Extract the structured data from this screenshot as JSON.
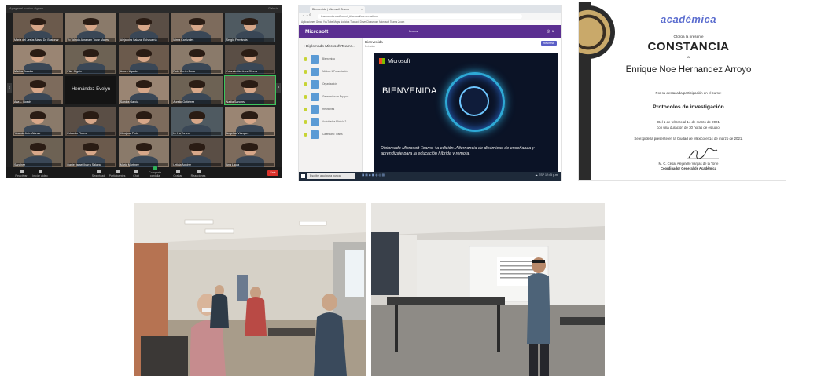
{
  "zoom": {
    "topbar_left": "Apagar el sonido alguno",
    "topbar_right": "Galería",
    "tiles": [
      {
        "name": "María del Jesús Alessi De Bastonar",
        "selected": false
      },
      {
        "name": "Yo Tolinda Abraham Tovar Mares",
        "selected": false
      },
      {
        "name": "Alejandra Salazar Echavarría",
        "selected": false
      },
      {
        "name": "Mirna Carrizales",
        "selected": false
      },
      {
        "name": "Sergio Fernández",
        "selected": false
      },
      {
        "name": "Martha Sandra",
        "selected": false
      },
      {
        "name": "Pilar Olguín",
        "selected": false
      },
      {
        "name": "Arturo Ugalde",
        "selected": false
      },
      {
        "name": "Rubí Cerón Bosa",
        "selected": false
      },
      {
        "name": "Yolanda Martínez Olvera",
        "selected": false
      },
      {
        "name": "Ana L. Bosch",
        "selected": false
      },
      {
        "name": "Hernández Evelyn",
        "selected": false,
        "textonly": true
      },
      {
        "name": "Sandra García",
        "selected": false
      },
      {
        "name": "Aurelio Gutiérrez",
        "selected": false
      },
      {
        "name": "Nadia Sánchez",
        "selected": true
      },
      {
        "name": "Yesenia Jaén Alonso",
        "selected": false
      },
      {
        "name": "Eduardo Flores",
        "selected": false
      },
      {
        "name": "Hinojosa Pinto",
        "selected": false
      },
      {
        "name": "Le Ha Torres",
        "selected": false
      },
      {
        "name": "Angelica Vázquez",
        "selected": false
      },
      {
        "name": "Sánchez",
        "selected": false
      },
      {
        "name": "Daniel Israel Ibarra Salazar",
        "selected": false
      },
      {
        "name": "Mario Martínez",
        "selected": false
      },
      {
        "name": "Leticia Aguirre",
        "selected": false
      },
      {
        "name": "Ana Laura",
        "selected": false
      }
    ],
    "controls": [
      "Reactivar",
      "Iniciar vídeo",
      "Seguridad",
      "Participantes",
      "Chat",
      "Compartir pantalla",
      "Grabar",
      "Reacciones"
    ],
    "end_label": "Salir"
  },
  "teams": {
    "tab_title": "Bienvenida | Microsoft Teams",
    "url": "teams.microsoft.com/_#/school/conversations",
    "bookmarks": "Aplicaciones   Gmail   YouTube   Maps   Noticias   Traducir   Drive   Classroom   Microsoft Teams   Zoom",
    "brand": "Microsoft",
    "search_label": "Buscar",
    "topicons": "⋯  ◎  ☺",
    "back_label": "‹  Diplomado Microsoft Teams...",
    "channel_title": "Bienvenida",
    "channel_sub": "Entradas",
    "meet_button": "Reunirse",
    "sidebar_items": [
      "Bienvenida",
      "Módulo 1 Presentación",
      "Organización",
      "Generación de Equipos",
      "Reuniones",
      "Actividades Módulo 2",
      "Calendario Teams"
    ],
    "video_logo": "Microsoft",
    "video_welcome": "BIENVENIDA",
    "video_caption": "Diplomado Microsoft Teams 4a edición. Alternancia de dinámicas de enseñanza y aprendizaje para la educación híbrida y remota.",
    "search_taskbar": "Escribe aquí para buscar",
    "tray": "☁ ESP  12:45 p.m."
  },
  "certificate": {
    "logo": "académica",
    "intro": "Otorga la presente",
    "title": "CONSTANCIA",
    "a": "a",
    "recipient": "Enrique Noe Hernandez Arroyo",
    "reason": "Por su destacada participación en el curso:",
    "course": "Protocolos de investigación",
    "dates": "Del 1 de febrero al 14 de marzo de 2021",
    "duration": "con una duración de 30 horas de estudio.",
    "issued": "Se expide la presente en la Ciudad de México el 14 de marzo de 2021.",
    "signer": "M. C. César Alejandro Vargas de la Torre",
    "signer_title": "Coordinador General de Académica"
  },
  "colors": {
    "teams_purple": "#5b2f91",
    "zoom_dark": "#1f1f1f",
    "cert_blue": "#5b6dcf",
    "zoom_end_red": "#d9322b"
  }
}
